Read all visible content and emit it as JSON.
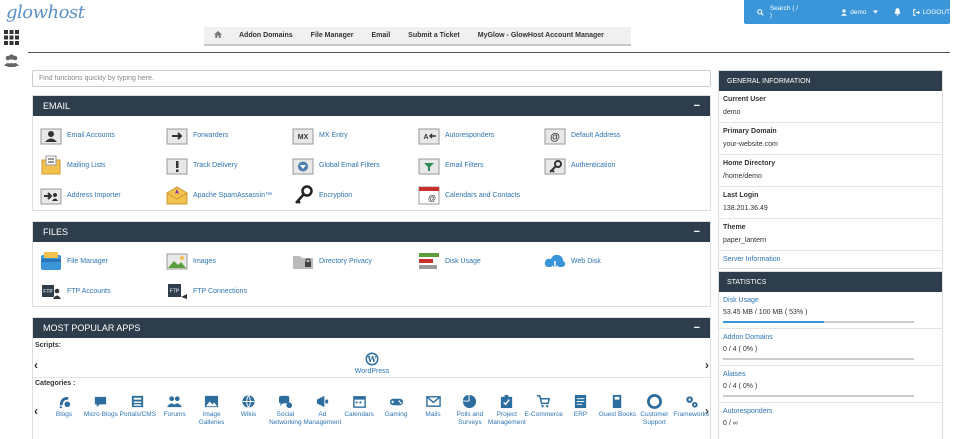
{
  "header": {
    "logo_text": "glowhost",
    "search_label": "Search ( / )",
    "user_label": "demo",
    "logout_label": "LOGOUT"
  },
  "nav": {
    "items": [
      "Addon Domains",
      "File Manager",
      "Email",
      "Submit a Ticket",
      "MyGlow - GlowHost Account Manager"
    ]
  },
  "search": {
    "placeholder": "Find functions quickly by typing here."
  },
  "email_panel": {
    "title": "EMAIL",
    "collapse": "−",
    "items": [
      "Email Accounts",
      "Forwarders",
      "MX Entry",
      "Autoresponders",
      "Default Address",
      "Mailing Lists",
      "Track Delivery",
      "Global Email Filters",
      "Email Filters",
      "Authentication",
      "Address Importer",
      "Apache SpamAssassin™",
      "Encryption",
      "Calendars and Contacts"
    ]
  },
  "files_panel": {
    "title": "FILES",
    "collapse": "−",
    "items": [
      "File Manager",
      "Images",
      "Directory Privacy",
      "Disk Usage",
      "Web Disk",
      "FTP Accounts",
      "FTP Connections"
    ]
  },
  "apps_panel": {
    "title": "MOST POPULAR APPS",
    "collapse": "−",
    "scripts_label": "Scripts:",
    "script_name": "WordPress",
    "categories_label": "Categories :",
    "categories": [
      "Blogs",
      "Micro Blogs",
      "Portals/CMS",
      "Forums",
      "Image Galleries",
      "Wikis",
      "Social Networking",
      "Ad Management",
      "Calendars",
      "Gaming",
      "Mails",
      "Polls and Surveys",
      "Project Management",
      "E-Commerce",
      "ERP",
      "Guest Books",
      "Customer Support",
      "Frameworks"
    ],
    "prev_arrow": "‹",
    "next_arrow": "›"
  },
  "general_info": {
    "title": "GENERAL INFORMATION",
    "rows": [
      {
        "k": "Current User",
        "v": "demo"
      },
      {
        "k": "Primary Domain",
        "v": "your-website.com"
      },
      {
        "k": "Home Directory",
        "v": "/home/demo"
      },
      {
        "k": "Last Login",
        "v": "138.201.36.49"
      },
      {
        "k": "Theme",
        "v": "paper_lantern"
      }
    ],
    "server_info_link": "Server Information"
  },
  "statistics": {
    "title": "STATISTICS",
    "rows": [
      {
        "k": "Disk Usage",
        "v": "53.45 MB / 100 MB ( 53% )",
        "fraction": 0.53
      },
      {
        "k": "Addon Domains",
        "v": "0 / 4 ( 0% )",
        "fraction": 0
      },
      {
        "k": "Aliases",
        "v": "0 / 4 ( 0% )",
        "fraction": 0
      },
      {
        "k": "Autoresponders",
        "v": "0 / ∞",
        "fraction": 0
      }
    ]
  },
  "colors": {
    "accent": "#3a95d9",
    "panel_header": "#2e3d4b",
    "link": "#2d74b5"
  }
}
